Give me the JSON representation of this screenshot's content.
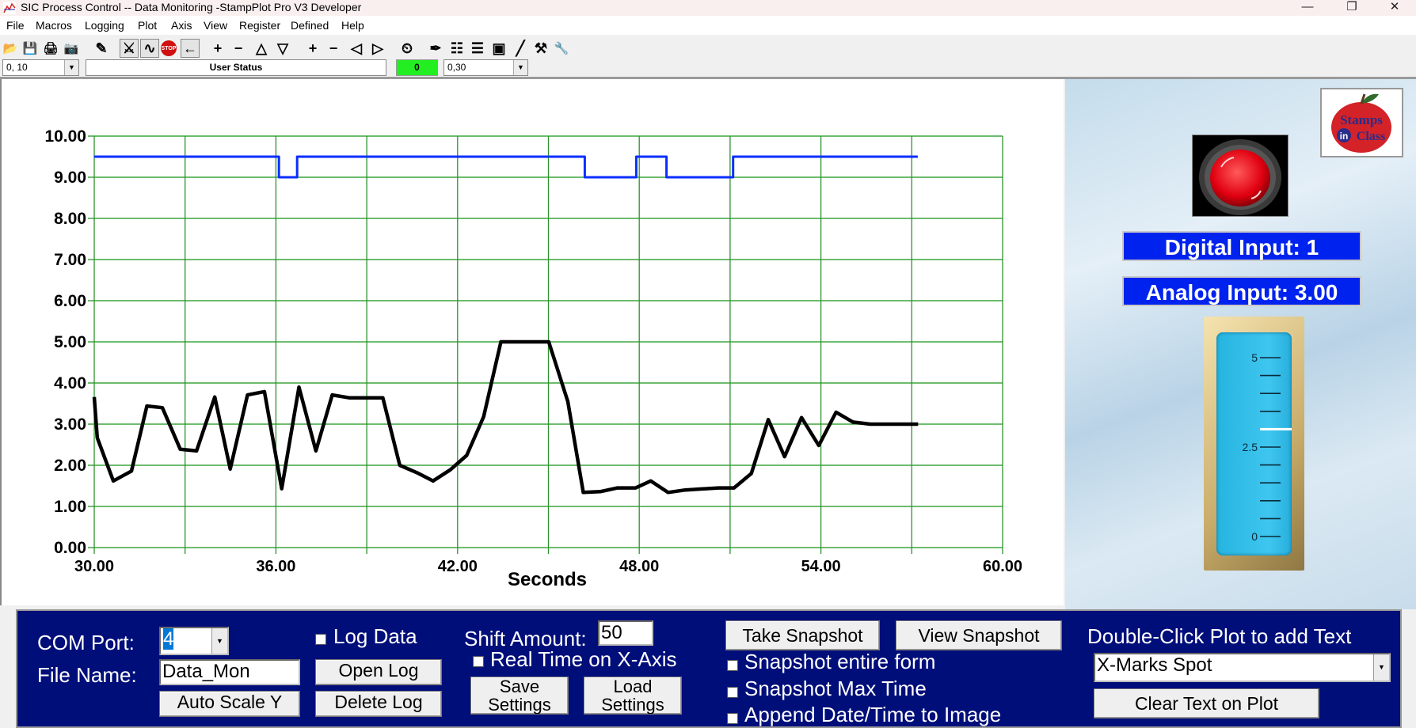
{
  "window": {
    "title": "SIC Process Control -- Data Monitoring  -StampPlot Pro V3 Developer",
    "controls": {
      "minimize": "—",
      "restore": "❐",
      "close": "✕"
    }
  },
  "menu": [
    "File",
    "Macros",
    "Logging",
    "Plot",
    "Axis",
    "View",
    "Register",
    "Defined",
    "Help"
  ],
  "toolbar": {
    "buttons": [
      {
        "name": "open-icon",
        "glyph": "📂"
      },
      {
        "name": "save-icon",
        "glyph": "💾"
      },
      {
        "name": "print-icon",
        "glyph": "🖨"
      },
      {
        "name": "camera-icon",
        "glyph": "📷"
      },
      {
        "name": "clear-plot-icon",
        "glyph": "✎"
      },
      {
        "name": "connect-icon",
        "glyph": "⚔"
      },
      {
        "name": "plot-on-icon",
        "glyph": "∿"
      },
      {
        "name": "stop-icon",
        "glyph": "STOP"
      },
      {
        "name": "arrow-left-icon",
        "glyph": "←"
      },
      {
        "name": "zoom-in-y-icon",
        "glyph": "+"
      },
      {
        "name": "zoom-out-y-icon",
        "glyph": "−"
      },
      {
        "name": "scroll-up-icon",
        "glyph": "△"
      },
      {
        "name": "scroll-down-icon",
        "glyph": "▽"
      },
      {
        "name": "zoom-in-x-icon",
        "glyph": "+"
      },
      {
        "name": "zoom-out-x-icon",
        "glyph": "−"
      },
      {
        "name": "scroll-left-icon",
        "glyph": "◁"
      },
      {
        "name": "scroll-right-icon",
        "glyph": "▷"
      },
      {
        "name": "clock-icon",
        "glyph": "⏲"
      },
      {
        "name": "pen-icon",
        "glyph": "✒"
      },
      {
        "name": "data-icon",
        "glyph": "☷"
      },
      {
        "name": "notes-icon",
        "glyph": "☰"
      },
      {
        "name": "device-icon",
        "glyph": "▣"
      },
      {
        "name": "probe-icon",
        "glyph": "╱"
      },
      {
        "name": "tools-icon",
        "glyph": "⚒"
      },
      {
        "name": "wrench-icon",
        "glyph": "🔧"
      }
    ],
    "left_combo": "0, 10",
    "user_status": "User Status",
    "counter": "0",
    "right_combo": "0,30"
  },
  "chart_data": {
    "type": "line",
    "title": "",
    "xlabel": "Seconds",
    "ylabel": "",
    "xlim": [
      30,
      60
    ],
    "ylim": [
      0,
      10
    ],
    "grid": true,
    "x_ticks": [
      "30.00",
      "36.00",
      "42.00",
      "48.00",
      "54.00",
      "60.00"
    ],
    "x_tick_values": [
      30,
      36,
      42,
      48,
      54,
      60
    ],
    "x_grid_step": 3,
    "y_ticks": [
      "0.00",
      "1.00",
      "2.00",
      "3.00",
      "4.00",
      "5.00",
      "6.00",
      "7.00",
      "8.00",
      "9.00",
      "10.00"
    ],
    "series": [
      {
        "name": "Analog Input",
        "color": "#000000",
        "x": [
          30.0,
          30.1,
          30.63,
          31.23,
          31.74,
          32.25,
          32.84,
          33.38,
          33.98,
          34.49,
          35.06,
          35.62,
          36.19,
          36.76,
          37.32,
          37.86,
          38.42,
          39.53,
          40.09,
          40.66,
          41.19,
          41.76,
          42.3,
          42.86,
          43.43,
          45.01,
          45.64,
          46.15,
          46.71,
          47.28,
          47.88,
          48.38,
          48.95,
          49.52,
          50.62,
          51.13,
          51.7,
          52.26,
          52.8,
          53.36,
          53.93,
          54.5,
          55.06,
          55.63,
          57.21
        ],
        "y": [
          3.66,
          2.67,
          1.62,
          1.86,
          3.44,
          3.4,
          2.39,
          2.35,
          3.66,
          1.91,
          3.71,
          3.79,
          1.43,
          3.9,
          2.35,
          3.71,
          3.64,
          3.64,
          2.0,
          1.82,
          1.62,
          1.89,
          2.24,
          3.18,
          5.0,
          5.0,
          3.55,
          1.34,
          1.36,
          1.45,
          1.45,
          1.62,
          1.34,
          1.4,
          1.45,
          1.45,
          1.8,
          3.11,
          2.21,
          3.16,
          2.48,
          3.29,
          3.05,
          3.0,
          3.0
        ]
      },
      {
        "name": "Digital Input",
        "color": "#0a2eff",
        "step": true,
        "x": [
          30.0,
          36.1,
          36.1,
          36.7,
          36.7,
          46.2,
          46.2,
          47.9,
          47.9,
          48.9,
          48.9,
          51.1,
          51.1,
          57.2
        ],
        "y": [
          9.5,
          9.5,
          9.0,
          9.0,
          9.5,
          9.5,
          9.0,
          9.0,
          9.5,
          9.5,
          9.0,
          9.0,
          9.5,
          9.5
        ]
      }
    ]
  },
  "right_panel": {
    "logo_text": [
      "Stamps",
      "in",
      "Class"
    ],
    "digital_input": "Digital Input: 1",
    "analog_input": "Analog Input: 3.00",
    "led_state": "on",
    "gauge": {
      "min": 0,
      "max": 5,
      "value": 3.0,
      "labels": [
        "5",
        "2.5",
        "0"
      ],
      "minor_ticks": 10
    }
  },
  "controls": {
    "com_port_label": "COM Port:",
    "com_port_value": "4",
    "file_name_label": "File Name:",
    "file_name_value": "Data_Mon",
    "auto_scale_y": "Auto Scale Y",
    "log_data": "Log Data",
    "open_log": "Open Log",
    "delete_log": "Delete Log",
    "shift_amount_label": "Shift Amount:",
    "shift_amount_value": "50",
    "real_time_x": "Real Time on X-Axis",
    "save_settings": [
      "Save",
      "Settings"
    ],
    "load_settings": [
      "Load",
      "Settings"
    ],
    "take_snapshot": "Take Snapshot",
    "view_snapshot": "View Snapshot",
    "snapshot_entire_form": "Snapshot entire form",
    "snapshot_max_time": "Snapshot Max Time",
    "append_datetime": "Append Date/Time to Image",
    "double_click_hint": "Double-Click Plot to add Text",
    "text_select_value": "X-Marks Spot",
    "clear_text": "Clear Text on Plot"
  }
}
